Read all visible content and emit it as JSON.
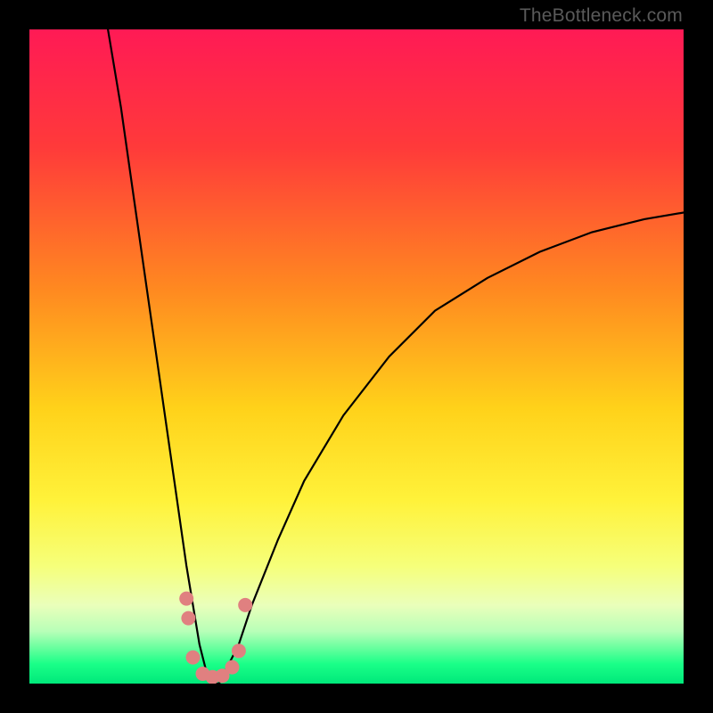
{
  "watermark": "TheBottleneck.com",
  "chart_data": {
    "type": "line",
    "title": "",
    "xlabel": "",
    "ylabel": "",
    "xlim": [
      0,
      100
    ],
    "ylim": [
      0,
      100
    ],
    "grid": false,
    "legend": false,
    "description": "V-shaped bottleneck curve on vertical rainbow gradient (red top through yellow to green bottom). Curve descends steeply from upper-left, reaches minimum near x≈28 at the green floor, then rises with a concave arc to the right edge at roughly 70% height. Small salmon-colored marker dots cluster near the valley bottom.",
    "series": [
      {
        "name": "curve",
        "x": [
          12,
          14,
          16,
          18,
          20,
          22,
          24,
          26,
          27,
          28,
          29,
          30,
          32,
          34,
          38,
          42,
          48,
          55,
          62,
          70,
          78,
          86,
          94,
          100
        ],
        "y": [
          100,
          88,
          74,
          60,
          46,
          32,
          18,
          6,
          2,
          0,
          0,
          2,
          6,
          12,
          22,
          31,
          41,
          50,
          57,
          62,
          66,
          69,
          71,
          72
        ]
      }
    ],
    "markers": {
      "name": "dots",
      "color": "#e08080",
      "points": [
        {
          "x": 24,
          "y": 13
        },
        {
          "x": 24.3,
          "y": 10
        },
        {
          "x": 25,
          "y": 4
        },
        {
          "x": 26.5,
          "y": 1.5
        },
        {
          "x": 28,
          "y": 1
        },
        {
          "x": 29.5,
          "y": 1.2
        },
        {
          "x": 31,
          "y": 2.5
        },
        {
          "x": 32,
          "y": 5
        },
        {
          "x": 33,
          "y": 12
        }
      ]
    },
    "gradient_stops": [
      {
        "offset": 0,
        "color": "#ff1a55"
      },
      {
        "offset": 18,
        "color": "#ff3a3a"
      },
      {
        "offset": 40,
        "color": "#ff8a20"
      },
      {
        "offset": 58,
        "color": "#ffd21a"
      },
      {
        "offset": 72,
        "color": "#fff23a"
      },
      {
        "offset": 82,
        "color": "#f6ff7a"
      },
      {
        "offset": 88,
        "color": "#eaffba"
      },
      {
        "offset": 92,
        "color": "#b8ffb8"
      },
      {
        "offset": 95,
        "color": "#5aff9a"
      },
      {
        "offset": 97,
        "color": "#1aff88"
      },
      {
        "offset": 100,
        "color": "#00e87a"
      }
    ]
  }
}
